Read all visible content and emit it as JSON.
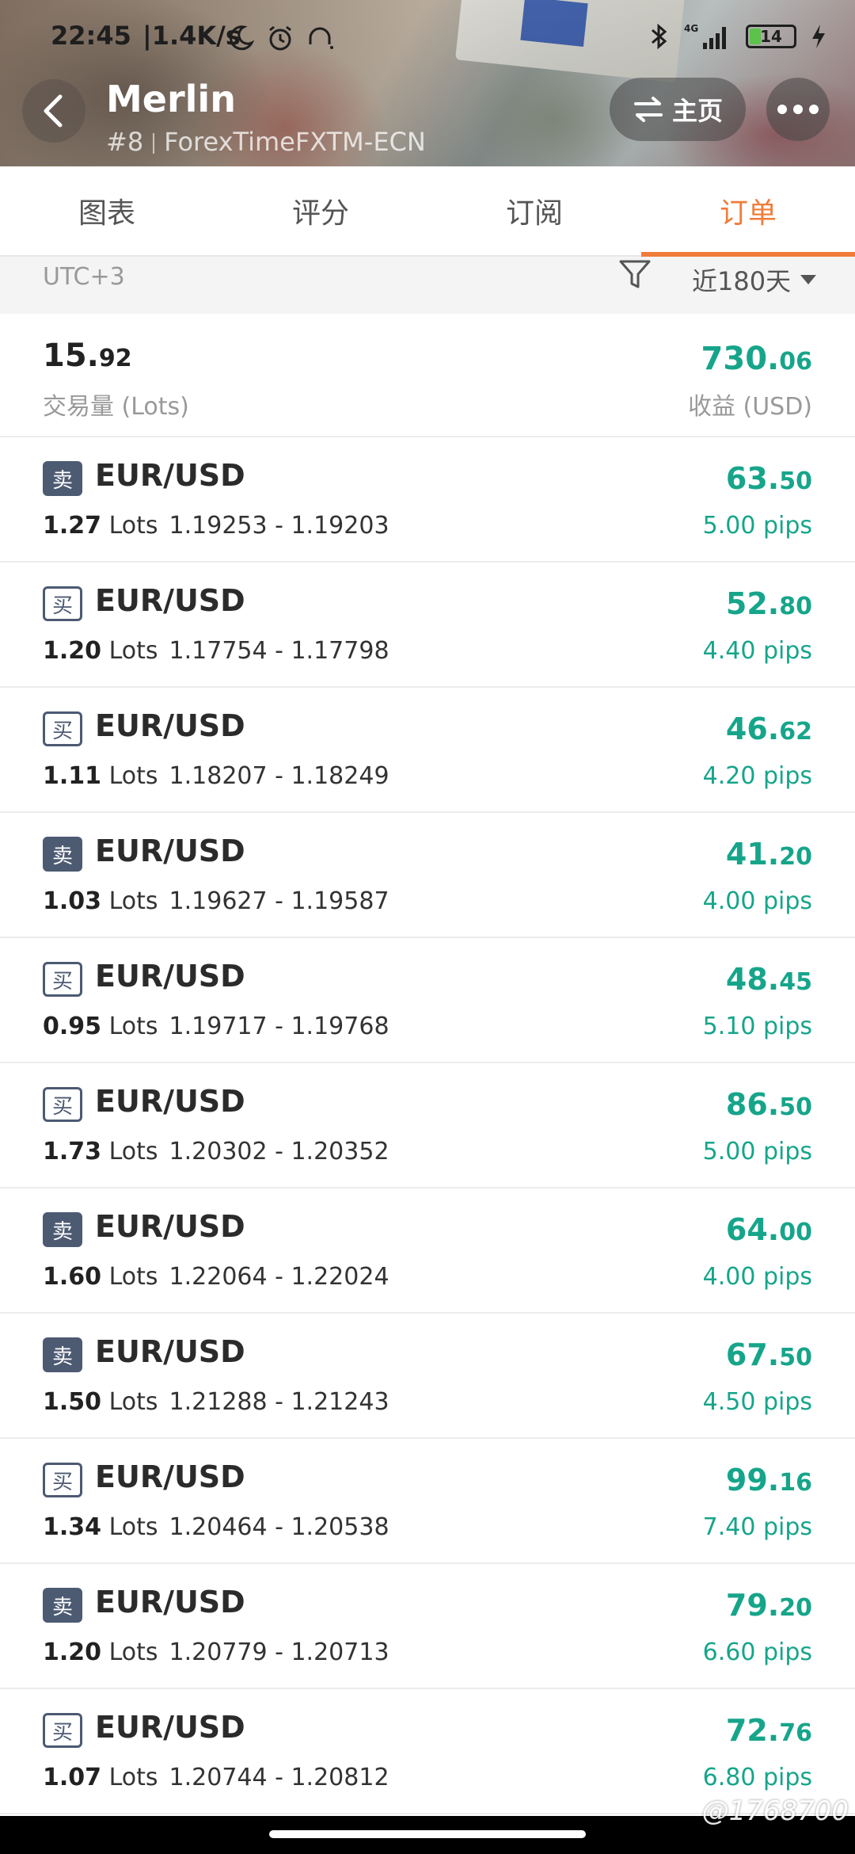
{
  "status_bar": {
    "time": "22:45",
    "speed": "|1.4K/s",
    "network": "4G",
    "battery": "14"
  },
  "header": {
    "title": "Merlin",
    "rank": "#8",
    "account": "ForexTimeFXTM-ECN",
    "home_label": "主页"
  },
  "tabs": [
    {
      "label": "图表"
    },
    {
      "label": "评分"
    },
    {
      "label": "订阅"
    },
    {
      "label": "订单",
      "active": true
    }
  ],
  "filter": {
    "timezone": "UTC+3",
    "range": "近180天"
  },
  "summary": {
    "lots_int": "15.",
    "lots_frac": "92",
    "lots_label": "交易量 (Lots)",
    "profit_int": "730.",
    "profit_frac": "06",
    "profit_label": "收益 (USD)"
  },
  "orders": [
    {
      "side": "卖",
      "type": "sell",
      "pair": "EUR/USD",
      "lots": "1.27",
      "lots_unit": "Lots",
      "prices": "1.19253 - 1.19203",
      "profit_int": "63.",
      "profit_frac": "50",
      "pips": "5.00 pips"
    },
    {
      "side": "买",
      "type": "buy",
      "pair": "EUR/USD",
      "lots": "1.20",
      "lots_unit": "Lots",
      "prices": "1.17754 - 1.17798",
      "profit_int": "52.",
      "profit_frac": "80",
      "pips": "4.40 pips"
    },
    {
      "side": "买",
      "type": "buy",
      "pair": "EUR/USD",
      "lots": "1.11",
      "lots_unit": "Lots",
      "prices": "1.18207 - 1.18249",
      "profit_int": "46.",
      "profit_frac": "62",
      "pips": "4.20 pips"
    },
    {
      "side": "卖",
      "type": "sell",
      "pair": "EUR/USD",
      "lots": "1.03",
      "lots_unit": "Lots",
      "prices": "1.19627 - 1.19587",
      "profit_int": "41.",
      "profit_frac": "20",
      "pips": "4.00 pips"
    },
    {
      "side": "买",
      "type": "buy",
      "pair": "EUR/USD",
      "lots": "0.95",
      "lots_unit": "Lots",
      "prices": "1.19717 - 1.19768",
      "profit_int": "48.",
      "profit_frac": "45",
      "pips": "5.10 pips"
    },
    {
      "side": "买",
      "type": "buy",
      "pair": "EUR/USD",
      "lots": "1.73",
      "lots_unit": "Lots",
      "prices": "1.20302 - 1.20352",
      "profit_int": "86.",
      "profit_frac": "50",
      "pips": "5.00 pips"
    },
    {
      "side": "卖",
      "type": "sell",
      "pair": "EUR/USD",
      "lots": "1.60",
      "lots_unit": "Lots",
      "prices": "1.22064 - 1.22024",
      "profit_int": "64.",
      "profit_frac": "00",
      "pips": "4.00 pips"
    },
    {
      "side": "卖",
      "type": "sell",
      "pair": "EUR/USD",
      "lots": "1.50",
      "lots_unit": "Lots",
      "prices": "1.21288 - 1.21243",
      "profit_int": "67.",
      "profit_frac": "50",
      "pips": "4.50 pips"
    },
    {
      "side": "买",
      "type": "buy",
      "pair": "EUR/USD",
      "lots": "1.34",
      "lots_unit": "Lots",
      "prices": "1.20464 - 1.20538",
      "profit_int": "99.",
      "profit_frac": "16",
      "pips": "7.40 pips"
    },
    {
      "side": "卖",
      "type": "sell",
      "pair": "EUR/USD",
      "lots": "1.20",
      "lots_unit": "Lots",
      "prices": "1.20779 - 1.20713",
      "profit_int": "79.",
      "profit_frac": "20",
      "pips": "6.60 pips"
    },
    {
      "side": "买",
      "type": "buy",
      "pair": "EUR/USD",
      "lots": "1.07",
      "lots_unit": "Lots",
      "prices": "1.20744 - 1.20812",
      "profit_int": "72.",
      "profit_frac": "76",
      "pips": "6.80 pips"
    }
  ],
  "watermark": "@1768700",
  "colors": {
    "accent": "#f07c3a",
    "profit": "#16a58a",
    "badge": "#4c5a72"
  },
  "icons": {
    "back": "chevron-left-icon",
    "home": "swap-arrows-icon",
    "more": "more-dots-icon",
    "filter": "funnel-icon",
    "range": "caret-down-icon"
  }
}
